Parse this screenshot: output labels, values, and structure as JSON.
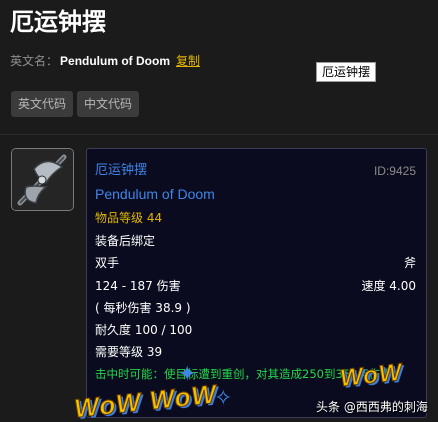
{
  "page": {
    "title": "厄运钟摆",
    "english_label": "英文名：",
    "english_name": "Pendulum of Doom",
    "copy_label": "复制",
    "tooltip_text": "厄运钟摆"
  },
  "buttons": {
    "english_code": "英文代码",
    "chinese_code": "中文代码"
  },
  "item": {
    "icon_name": "axe-weapon-icon",
    "name_cn": "厄运钟摆",
    "id_text": "ID:9425",
    "name_en": "Pendulum of Doom",
    "item_level": "物品等级 44",
    "bind": "装备后绑定",
    "slot": "双手",
    "type": "斧",
    "damage": "124 - 187 伤害",
    "speed": "速度 4.00",
    "dps": "( 每秒伤害 38.9 )",
    "durability": "耐久度 100 / 100",
    "required_level": "需要等级 39",
    "effect": "击中时可能：使目标遭到重创，对其造成250到351点伤害。"
  },
  "overlay": {
    "sticker_left": "WoW WoW",
    "sticker_right": "WoW",
    "watermark": "头条 @西西弗的刺海"
  },
  "colors": {
    "background": "#1b1b1b",
    "item_name_blue": "#3f85e8",
    "item_level_gold": "#e2b600",
    "effect_green": "#24d84b",
    "copy_link": "#e2b600"
  }
}
